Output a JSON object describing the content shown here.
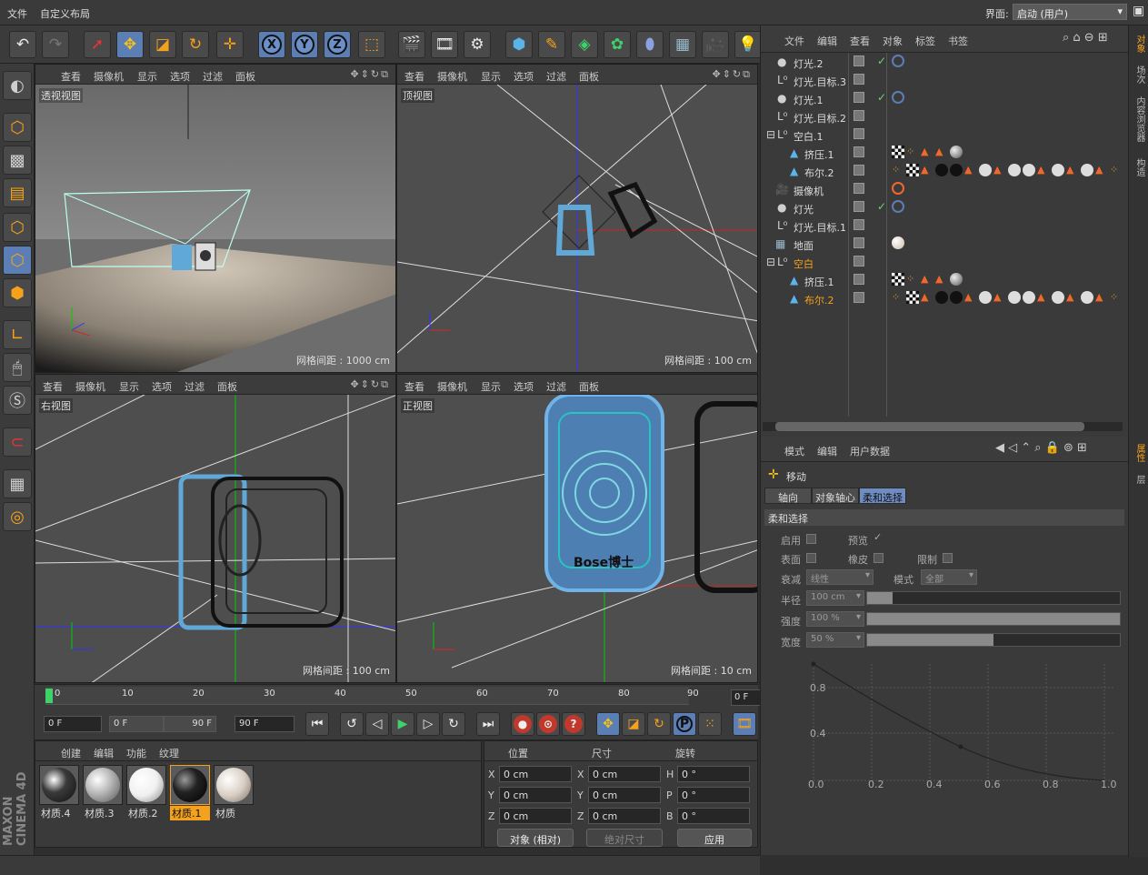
{
  "menubar": {
    "items": [
      "文件",
      "自定义布局"
    ],
    "layout_label": "界面:",
    "layout_value": "启动 (用户)"
  },
  "toolbar": {
    "tools": [
      "undo-icon",
      "redo-icon",
      "live-select-icon",
      "move-icon",
      "scale-icon",
      "rotate-icon",
      "move-add-icon",
      "x-axis",
      "y-axis",
      "z-axis",
      "coord-system-icon",
      "render-view-icon",
      "render-picture-icon",
      "render-settings-icon",
      "cube-icon",
      "pen-icon",
      "subdivision-icon",
      "array-icon",
      "deformer-icon",
      "floor-icon",
      "camera-icon",
      "light-icon"
    ],
    "axis_x": "X",
    "axis_y": "Y",
    "axis_z": "Z"
  },
  "viewport_menu": [
    "查看",
    "摄像机",
    "显示",
    "选项",
    "过滤",
    "面板"
  ],
  "viewports": [
    {
      "label": "透视视图",
      "grid": "网格间距 : 1000 cm"
    },
    {
      "label": "顶视图",
      "grid": "网格间距 : 100 cm"
    },
    {
      "label": "右视图",
      "grid": "网格间距 : 100 cm"
    },
    {
      "label": "正视图",
      "grid": "网格间距 : 10 cm"
    }
  ],
  "front_view_text": "Bose博士",
  "timeline": {
    "ticks": [
      "0",
      "10",
      "20",
      "30",
      "40",
      "50",
      "60",
      "70",
      "80",
      "90"
    ],
    "current_frame": "0 F"
  },
  "transport": {
    "start": "0 F",
    "range_start": "0 F",
    "range_end": "90 F",
    "end": "90 F",
    "record_label": "P"
  },
  "materials": {
    "menu": [
      "创建",
      "编辑",
      "功能",
      "纹理"
    ],
    "items": [
      {
        "name": "材质.4",
        "color": "#3a3a3a"
      },
      {
        "name": "材质.3",
        "color": "#b5b5b5"
      },
      {
        "name": "材质.2",
        "color": "#f0f0f0"
      },
      {
        "name": "材质.1",
        "color": "#222222",
        "selected": true
      },
      {
        "name": "材质",
        "color": "#d9cfc4"
      }
    ]
  },
  "coords": {
    "headers": [
      "位置",
      "尺寸",
      "旋转"
    ],
    "rows": [
      {
        "a": "X",
        "pos": "0 cm",
        "b": "X",
        "size": "0 cm",
        "c": "H",
        "rot": "0 °"
      },
      {
        "a": "Y",
        "pos": "0 cm",
        "b": "Y",
        "size": "0 cm",
        "c": "P",
        "rot": "0 °"
      },
      {
        "a": "Z",
        "pos": "0 cm",
        "b": "Z",
        "size": "0 cm",
        "c": "B",
        "rot": "0 °"
      }
    ],
    "mode": "对象 (相对)",
    "size_mode": "绝对尺寸",
    "apply": "应用"
  },
  "object_manager": {
    "menu": [
      "文件",
      "编辑",
      "查看",
      "对象",
      "标签",
      "书签"
    ],
    "objects": [
      {
        "name": "灯光.2",
        "indent": 0,
        "icon": "light-icon",
        "check": true
      },
      {
        "name": "灯光.目标.3",
        "indent": 0,
        "icon": "null-icon"
      },
      {
        "name": "灯光.1",
        "indent": 0,
        "icon": "light-icon",
        "check": true
      },
      {
        "name": "灯光.目标.2",
        "indent": 0,
        "icon": "null-icon"
      },
      {
        "name": "空白.1",
        "indent": 0,
        "icon": "null-icon"
      },
      {
        "name": "挤压.1",
        "indent": 1,
        "icon": "extrude-icon"
      },
      {
        "name": "布尔.2",
        "indent": 1,
        "icon": "boole-icon"
      },
      {
        "name": "摄像机",
        "indent": 0,
        "icon": "camera-icon"
      },
      {
        "name": "灯光",
        "indent": 0,
        "icon": "light-icon",
        "check": true
      },
      {
        "name": "灯光.目标.1",
        "indent": 0,
        "icon": "null-icon"
      },
      {
        "name": "地面",
        "indent": 0,
        "icon": "floor-icon"
      },
      {
        "name": "空白",
        "indent": 0,
        "icon": "null-icon",
        "highlight": true
      },
      {
        "name": "挤压.1",
        "indent": 1,
        "icon": "extrude-icon"
      },
      {
        "name": "布尔.2",
        "indent": 1,
        "icon": "boole-icon",
        "highlight": true
      }
    ]
  },
  "attributes": {
    "menu": [
      "模式",
      "编辑",
      "用户数据"
    ],
    "tool_name": "移动",
    "tabs": [
      "轴向",
      "对象轴心",
      "柔和选择"
    ],
    "section": "柔和选择",
    "enable": "启用",
    "preview": "预览",
    "surface": "表面",
    "rubber": "橡皮",
    "limit": "限制",
    "falloff_label": "衰减",
    "falloff": "线性",
    "mode_label": "模式",
    "mode": "全部",
    "radius_label": "半径",
    "radius": "100 cm",
    "radius_fill": 0.1,
    "strength_label": "强度",
    "strength": "100 %",
    "strength_fill": 1.0,
    "width_label": "宽度",
    "width": "50 %",
    "width_fill": 0.5,
    "curve_y_ticks": [
      "0.8",
      "0.4"
    ],
    "curve_x_ticks": [
      "0.0",
      "0.2",
      "0.4",
      "0.6",
      "0.8",
      "1.0"
    ]
  },
  "right_tabs": [
    "对象",
    "场次",
    "内容浏览器",
    "构造",
    "属性",
    "层"
  ],
  "brand": "MAXON CINEMA 4D"
}
